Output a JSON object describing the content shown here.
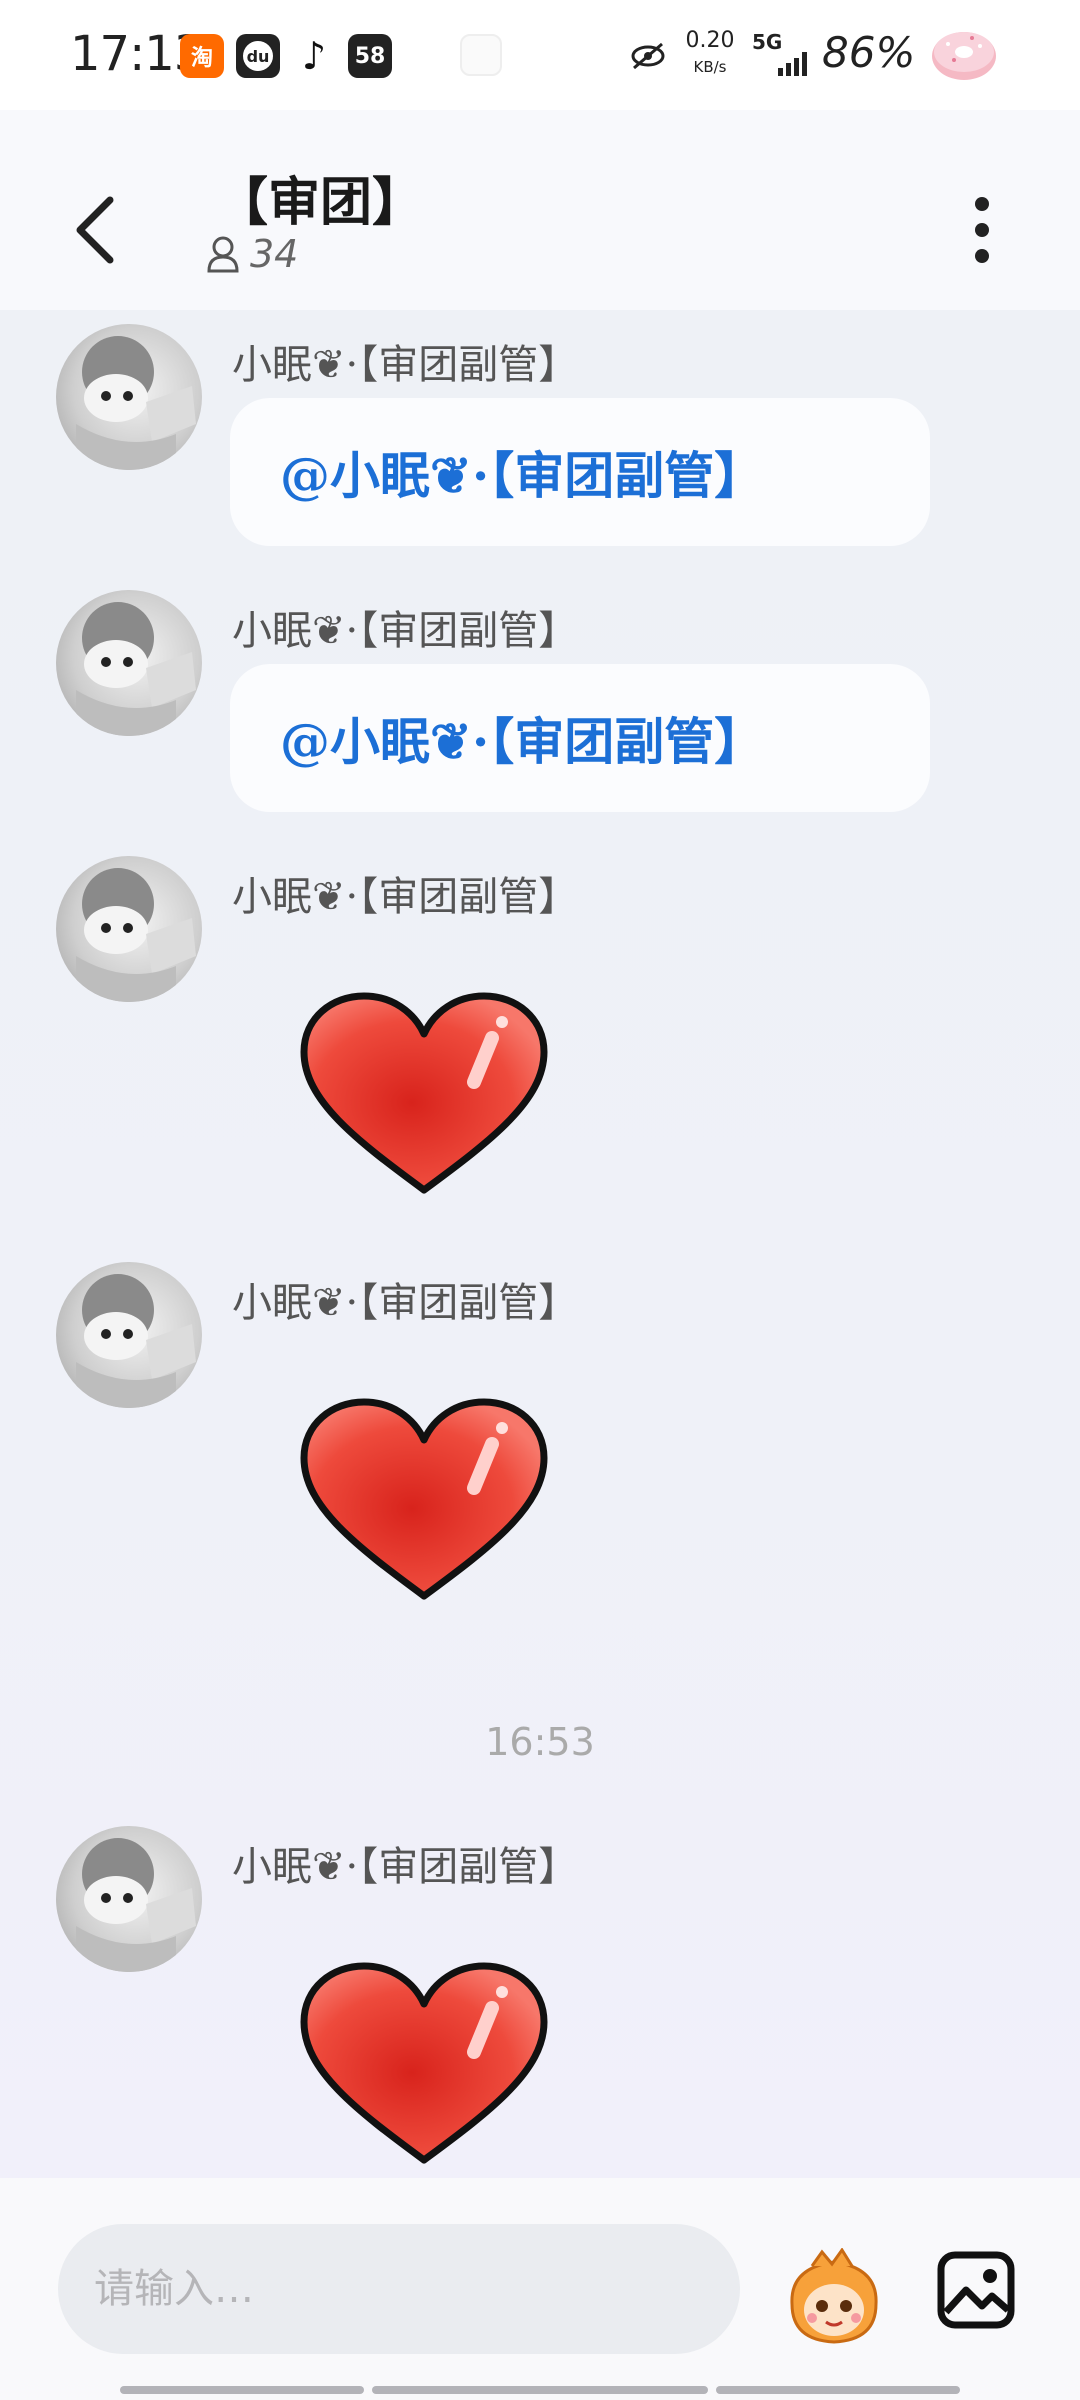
{
  "status_bar": {
    "time": "17:13",
    "apps": [
      {
        "name": "taobao-icon",
        "glyph": "淘",
        "color": "#ff6a00"
      },
      {
        "name": "du-icon",
        "glyph": "du",
        "color": "#222222"
      },
      {
        "name": "tiktok-icon",
        "glyph": "♪",
        "color": "#ffffff"
      },
      {
        "name": "58-icon",
        "glyph": "58",
        "color": "#222222"
      }
    ],
    "net_speed": "0.20",
    "net_speed_unit": "KB/s",
    "network": "5G",
    "battery": "86%"
  },
  "header": {
    "title": "【审团】",
    "member_count": "34"
  },
  "chat": {
    "sender_name": "小眠❦·【审团副管】",
    "messages": [
      {
        "type": "text",
        "text": "@小眠❦·【审团副管】"
      },
      {
        "type": "text",
        "text": "@小眠❦·【审团副管】"
      },
      {
        "type": "sticker",
        "sticker": "red-heart"
      },
      {
        "type": "sticker",
        "sticker": "red-heart"
      },
      {
        "type": "sticker",
        "sticker": "red-heart"
      }
    ],
    "timestamp": "16:53"
  },
  "input": {
    "placeholder": "请输入…"
  },
  "colors": {
    "mention": "#1c6fd6",
    "heart": "#e8322c",
    "chat_bg": "#eef1f6"
  }
}
